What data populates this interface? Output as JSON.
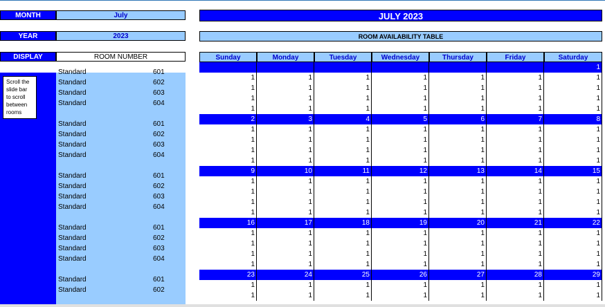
{
  "controls": {
    "month_label": "MONTH",
    "month_value": "July",
    "year_label": "YEAR",
    "year_value": "2023",
    "display_label": "DISPLAY",
    "display_value": "ROOM NUMBER"
  },
  "titles": {
    "main": "JULY 2023",
    "sub": "ROOM AVAILABILITY TABLE"
  },
  "note": "Scroll the slide bar to scroll between rooms",
  "days": [
    "Sunday",
    "Monday",
    "Tuesday",
    "Wednesday",
    "Thursday",
    "Friday",
    "Saturday"
  ],
  "weeks": [
    {
      "dates": [
        "",
        "",
        "",
        "",
        "",
        "",
        "1"
      ]
    },
    {
      "dates": [
        "2",
        "3",
        "4",
        "5",
        "6",
        "7",
        "8"
      ]
    },
    {
      "dates": [
        "9",
        "10",
        "11",
        "12",
        "13",
        "14",
        "15"
      ]
    },
    {
      "dates": [
        "16",
        "17",
        "18",
        "19",
        "20",
        "21",
        "22"
      ]
    },
    {
      "dates": [
        "23",
        "24",
        "25",
        "26",
        "27",
        "28",
        "29"
      ]
    }
  ],
  "rooms": [
    {
      "type": "Standard",
      "number": "601"
    },
    {
      "type": "Standard",
      "number": "602"
    },
    {
      "type": "Standard",
      "number": "603"
    },
    {
      "type": "Standard",
      "number": "604"
    }
  ],
  "availability_value": "1",
  "colors": {
    "accent": "#0000ff",
    "light": "#99ccff"
  }
}
